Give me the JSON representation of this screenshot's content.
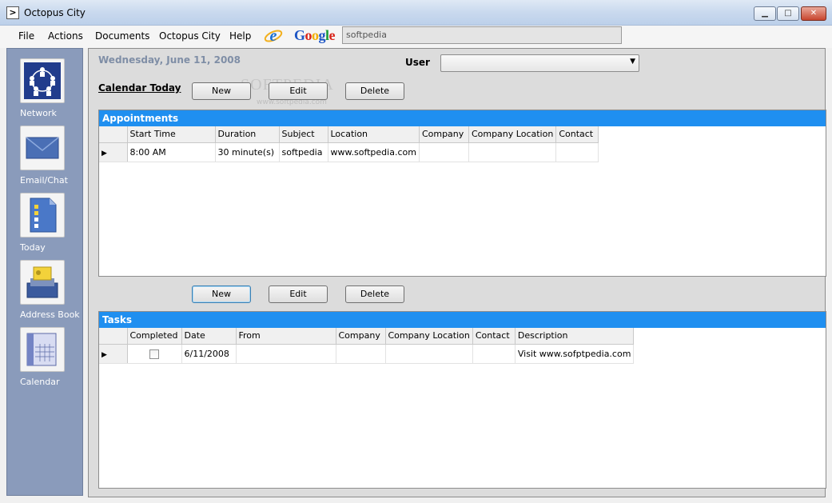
{
  "window": {
    "title": "Octopus City",
    "min": "▁",
    "max": "□",
    "close": "✕"
  },
  "menu": {
    "items": [
      "File",
      "Actions",
      "Documents",
      "Octopus City",
      "Help"
    ],
    "google": "Google",
    "search_value": "softpedia"
  },
  "sidebar": {
    "items": [
      {
        "label": "Network",
        "icon": "network-icon"
      },
      {
        "label": "Email/Chat",
        "icon": "envelope-icon"
      },
      {
        "label": "Today",
        "icon": "checklist-icon"
      },
      {
        "label": "Address Book",
        "icon": "address-book-icon"
      },
      {
        "label": "Calendar",
        "icon": "calendar-icon"
      }
    ]
  },
  "main": {
    "date": "Wednesday, June 11, 2008",
    "user_label": "User",
    "user_value": "",
    "calendar_today": "Calendar Today",
    "watermark": "SOFTPEDIA",
    "watermark_sub": "www.softpedia.com",
    "buttons": {
      "new": "New",
      "edit": "Edit",
      "delete": "Delete"
    }
  },
  "appointments": {
    "title": "Appointments",
    "columns": [
      "Start Time",
      "Duration",
      "Subject",
      "Location",
      "Company",
      "Company Location",
      "Contact"
    ],
    "rows": [
      [
        "8:00 AM",
        "30 minute(s)",
        "softpedia",
        "www.softpedia.com",
        "",
        "",
        ""
      ]
    ]
  },
  "tasks": {
    "title": "Tasks",
    "columns": [
      "Completed",
      "Date",
      "From",
      "Company",
      "Company Location",
      "Contact",
      "Description"
    ],
    "rows": [
      {
        "completed": false,
        "date": "6/11/2008",
        "from": "",
        "company": "",
        "company_location": "",
        "contact": "",
        "description": "Visit www.sofptpedia.com"
      }
    ]
  },
  "colors": {
    "panel_header": "#1f8ff0",
    "sidebar": "#8a9bbb",
    "date_text": "#7f8ea6"
  }
}
